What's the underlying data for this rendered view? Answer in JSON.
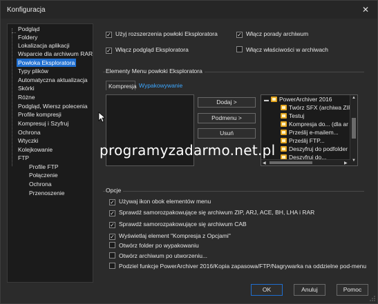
{
  "window": {
    "title": "Konfiguracja"
  },
  "tree": {
    "items": [
      "Podgląd",
      "Foldery",
      "Lokalizacja aplikacji",
      "Wsparcie dla archiwum RAR",
      "Powłoka Eksploratora",
      "Typy plików",
      "Automatyczna aktualizacja",
      "Skórki",
      "Różne",
      "Podgląd, Wiersz polecenia",
      "Profile kompresji",
      "Kompresuj i Szyfruj",
      "Ochrona",
      "Wtyczki",
      "Kolejkowanie",
      "FTP"
    ],
    "selected": "Powłoka Eksploratora",
    "subitems": [
      "Profile FTP",
      "Połączenie",
      "Ochrona",
      "Przenoszenie"
    ]
  },
  "top_options": {
    "use_shell_ext": {
      "label": "Użyj rozszerzenia powłoki Eksploratora",
      "checked": true
    },
    "archive_tips": {
      "label": "Włącz porady archiwum",
      "checked": true
    },
    "explorer_preview": {
      "label": "Włącz podgląd Eksploratora",
      "checked": true
    },
    "archive_properties": {
      "label": "Włącz właściwości w archiwach",
      "checked": false
    }
  },
  "menu_group": {
    "title": "Elementy Menu powłoki Eksploratora",
    "tabs": [
      "Kompresja",
      "Wypakowywanie"
    ],
    "buttons": {
      "add": "Dodaj >",
      "submenu": "Podmenu >",
      "remove": "Usuń"
    },
    "context_tree": [
      "PowerArchiver 2016",
      "Twórz SFX (archiwa ZIP",
      "Testuj",
      "Kompresja do... (dla ar",
      "Prześlij e-mailem...",
      "Prześlij FTP...",
      "Deszyfruj do podfolder",
      "Deszyfruj do..."
    ]
  },
  "watermark": "programyzadarmo.net.pl",
  "options_group": {
    "title": "Opcje",
    "items": [
      {
        "label": "Używaj ikon obok elementów menu",
        "checked": true
      },
      {
        "label": "Sprawdź samorozpakowujące się archiwum ZIP, ARJ, ACE, BH, LHA i RAR",
        "checked": true
      },
      {
        "label": "Sprawdź samorozpakowujące się archiwum CAB",
        "checked": true
      },
      {
        "label": "Wyświetlaj element \"Kompresja z Opcjami\"",
        "checked": true
      },
      {
        "label": "Otwórz folder po wypakowaniu",
        "checked": false
      },
      {
        "label": "Otwórz archiwum po utworzeniu...",
        "checked": false
      },
      {
        "label": "Podziel funkcje PowerArchiver 2016/Kopia zapasowa/FTP/Nagrywarka na oddzielne pod-menu",
        "checked": false
      }
    ]
  },
  "footer": {
    "ok": "OK",
    "cancel": "Anuluj",
    "help": "Pomoc"
  },
  "colors": {
    "accent": "#1f6fd1",
    "link": "#3da7ff",
    "background": "#2b2b2b",
    "folder": "#e3a51f"
  },
  "icons": {
    "close": "close-icon",
    "folder": "folder-icon",
    "cursor": "mouse-pointer-icon"
  }
}
